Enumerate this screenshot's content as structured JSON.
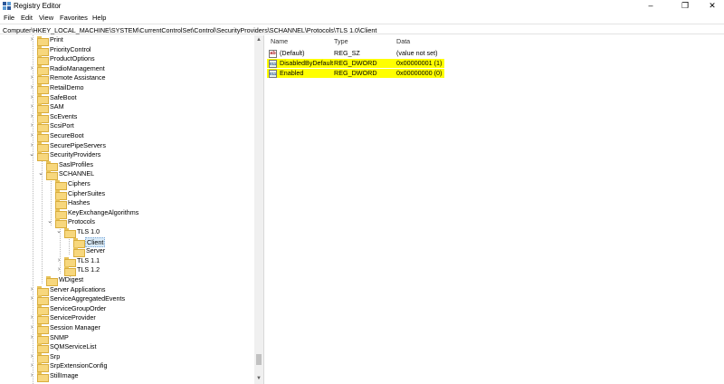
{
  "window": {
    "title": "Registry Editor",
    "minimize": "–",
    "maximize": "❐",
    "close": "✕"
  },
  "menu": [
    "File",
    "Edit",
    "View",
    "Favorites",
    "Help"
  ],
  "address": "Computer\\HKEY_LOCAL_MACHINE\\SYSTEM\\CurrentControlSet\\Control\\SecurityProviders\\SCHANNEL\\Protocols\\TLS 1.0\\Client",
  "tree": [
    {
      "label": "Print",
      "depth": 0,
      "expander": "collapsed"
    },
    {
      "label": "PriorityControl",
      "depth": 0,
      "expander": "none"
    },
    {
      "label": "ProductOptions",
      "depth": 0,
      "expander": "none"
    },
    {
      "label": "RadioManagement",
      "depth": 0,
      "expander": "collapsed"
    },
    {
      "label": "Remote Assistance",
      "depth": 0,
      "expander": "collapsed"
    },
    {
      "label": "RetailDemo",
      "depth": 0,
      "expander": "collapsed"
    },
    {
      "label": "SafeBoot",
      "depth": 0,
      "expander": "collapsed"
    },
    {
      "label": "SAM",
      "depth": 0,
      "expander": "collapsed"
    },
    {
      "label": "ScEvents",
      "depth": 0,
      "expander": "collapsed"
    },
    {
      "label": "ScsiPort",
      "depth": 0,
      "expander": "collapsed"
    },
    {
      "label": "SecureBoot",
      "depth": 0,
      "expander": "collapsed"
    },
    {
      "label": "SecurePipeServers",
      "depth": 0,
      "expander": "collapsed"
    },
    {
      "label": "SecurityProviders",
      "depth": 0,
      "expander": "expanded"
    },
    {
      "label": "SaslProfiles",
      "depth": 1,
      "expander": "none"
    },
    {
      "label": "SCHANNEL",
      "depth": 1,
      "expander": "expanded"
    },
    {
      "label": "Ciphers",
      "depth": 2,
      "expander": "none"
    },
    {
      "label": "CipherSuites",
      "depth": 2,
      "expander": "none"
    },
    {
      "label": "Hashes",
      "depth": 2,
      "expander": "none"
    },
    {
      "label": "KeyExchangeAlgorithms",
      "depth": 2,
      "expander": "none"
    },
    {
      "label": "Protocols",
      "depth": 2,
      "expander": "expanded"
    },
    {
      "label": "TLS 1.0",
      "depth": 3,
      "expander": "expanded"
    },
    {
      "label": "Client",
      "depth": 4,
      "expander": "none",
      "selected": true
    },
    {
      "label": "Server",
      "depth": 4,
      "expander": "none"
    },
    {
      "label": "TLS 1.1",
      "depth": 3,
      "expander": "collapsed"
    },
    {
      "label": "TLS 1.2",
      "depth": 3,
      "expander": "collapsed"
    },
    {
      "label": "WDigest",
      "depth": 1,
      "expander": "none"
    },
    {
      "label": "Server Applications",
      "depth": 0,
      "expander": "collapsed"
    },
    {
      "label": "ServiceAggregatedEvents",
      "depth": 0,
      "expander": "collapsed"
    },
    {
      "label": "ServiceGroupOrder",
      "depth": 0,
      "expander": "none"
    },
    {
      "label": "ServiceProvider",
      "depth": 0,
      "expander": "collapsed"
    },
    {
      "label": "Session Manager",
      "depth": 0,
      "expander": "collapsed"
    },
    {
      "label": "SNMP",
      "depth": 0,
      "expander": "collapsed"
    },
    {
      "label": "SQMServiceList",
      "depth": 0,
      "expander": "none"
    },
    {
      "label": "Srp",
      "depth": 0,
      "expander": "collapsed"
    },
    {
      "label": "SrpExtensionConfig",
      "depth": 0,
      "expander": "collapsed"
    },
    {
      "label": "StillImage",
      "depth": 0,
      "expander": "collapsed"
    }
  ],
  "values": {
    "columns": [
      "Name",
      "Type",
      "Data"
    ],
    "rows": [
      {
        "name": "(Default)",
        "type": "REG_SZ",
        "data": "(value not set)",
        "icon": "string-value-icon",
        "highlight": false
      },
      {
        "name": "DisabledByDefault",
        "type": "REG_DWORD",
        "data": "0x00000001 (1)",
        "icon": "dword-value-icon",
        "highlight": true
      },
      {
        "name": "Enabled",
        "type": "REG_DWORD",
        "data": "0x00000000 (0)",
        "icon": "dword-value-icon",
        "highlight": true
      }
    ]
  },
  "colors": {
    "highlight": "#ffff00",
    "folder": "#f7d77d",
    "selection": "#d9ebf9"
  }
}
